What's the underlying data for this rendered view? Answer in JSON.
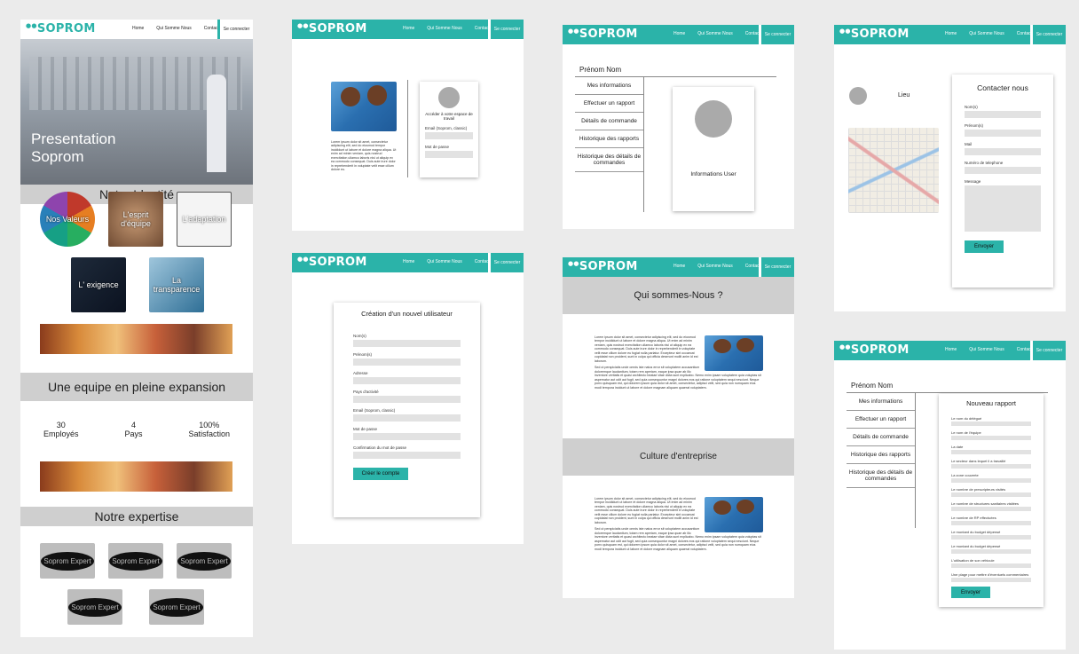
{
  "brand": {
    "logo_text": "SOPROM",
    "teal": "#2bb3a9"
  },
  "nav": {
    "home": "Home",
    "about": "Qui Somme Nous",
    "contact": "Contact",
    "login": "Se connecter"
  },
  "home": {
    "hero_title": "Presentation Soprom",
    "identity_heading": "Notre Identité",
    "identity_tiles": [
      "Nos Valeurs",
      "L'esprit d'équipe",
      "L'adaptation",
      "L' exigence",
      "La transparence"
    ],
    "expansion_heading": "Une equipe en pleine expansion",
    "stats": [
      {
        "value": "30",
        "label": "Employés"
      },
      {
        "value": "4",
        "label": "Pays"
      },
      {
        "value": "100%",
        "label": "Satisfaction"
      }
    ],
    "expertise_heading": "Notre expertise",
    "expertise_tiles": [
      "Soprom Expert",
      "Soprom Expert",
      "Soprom Expert",
      "Soprom Expert",
      "Soprom Expert"
    ]
  },
  "login": {
    "access_text": "Accéder à votre espace de travail",
    "email_label": "Email (Soprom, classic)",
    "password_label": "Mot de passe",
    "body_text": "Lorem ipsum dolor sit amet, consectetur adipiscing elit, sed do eiusmod tempor incididunt ut labore et dolore magna aliqua. Ut enim ad minim veniam, quis nostrud exercitation ullamco laboris nisi ut aliquip ex ea commodo consequat. Duis aute irure dolor in reprehenderit in voluptate velit esse cillum dolore eu."
  },
  "dashboard": {
    "user_name": "Prénom Nom",
    "menu": [
      "Mes informations",
      "Effectuer un rapport",
      "Détails de commande",
      "Historique des rapports",
      "Historique des détails de commandes"
    ],
    "info_caption": "Informations User"
  },
  "contact": {
    "location_label": "Lieu",
    "title": "Contacter nous",
    "fields": [
      "Nom(s)",
      "Prénom(s)",
      "Mail",
      "Numéro de telephone",
      "Message"
    ],
    "submit": "Envoyer"
  },
  "signup": {
    "title": "Création d'un nouvel utilisateur",
    "fields": [
      "Nom(s)",
      "Prénom(s)",
      "Adresse",
      "Pays d'activité",
      "Email (Soprom, classic)",
      "Mot de passe",
      "Confirmation du mot de passe"
    ],
    "submit": "Créer le compte"
  },
  "about": {
    "title": "Qui sommes-Nous ?",
    "culture_title": "Culture d'entreprise",
    "body_text": "Lorem ipsum dolor sit amet, consectetur adipiscing elit, sed do eiusmod tempor incididunt ut labore et dolore magna aliqua. Ut enim ad minim veniam, quis nostrud exercitation ullamco laboris nisi ut aliquip ex ea commodo consequat. Duis aute irure dolor in reprehenderit in voluptate velit esse cillum dolore eu fugiat nulla pariatur. Excepteur sint occaecat cupidatat non proident, sunt in culpa qui officia deserunt mollit anim id est laborum.",
    "body_text_2": "Sed ut perspiciatis unde omnis iste natus error sit voluptatem accusantium doloremque laudantium, totam rem aperiam, eaque ipsa quae ab illo inventore veritatis et quasi architecto beatae vitae dicta sunt explicabo. Nemo enim ipsam voluptatem quia voluptas sit aspernatur aut odit aut fugit, sed quia consequuntur magni dolores eos qui ratione voluptatem sequi nesciunt. Neque porro quisquam est, qui dolorem ipsum quia dolor sit amet, consectetur, adipisci velit, sed quia non numquam eius modi tempora incidunt ut labore et dolore magnam aliquam quaerat voluptatem."
  },
  "report": {
    "user_name": "Prénom Nom",
    "menu": [
      "Mes informations",
      "Effectuer un rapport",
      "Détails de commande",
      "Historique des rapports",
      "Historique des détails de commandes"
    ],
    "title": "Nouveau rapport",
    "fields": [
      "Le nom du délégué",
      "Le nom de l'équipe",
      "La date",
      "Le secteur dans lequel il a travaillé",
      "La zone couverte",
      "Le nombre de prescripteurs visités",
      "Le nombre de structures sanitaires visitées",
      "Le nombre de RP effectuées",
      "Le montant du budget dépensé",
      "Le montant du budget dépensé",
      "L'utilisation de son véhicule",
      "Une plage pour mettre d'éventuels commentaires"
    ],
    "submit": "Envoyer"
  }
}
